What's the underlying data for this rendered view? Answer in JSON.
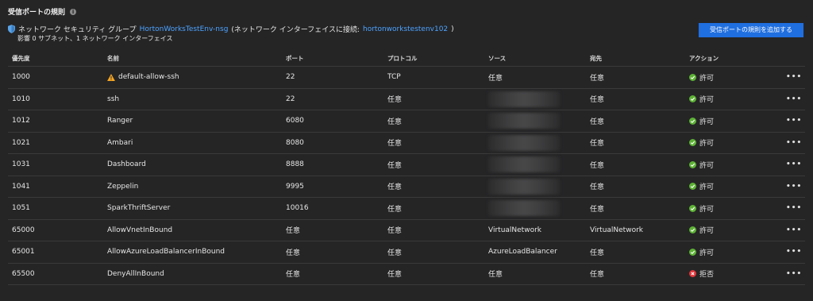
{
  "header": {
    "title": "受信ポートの規則",
    "nsg_prefix": "ネットワーク セキュリティ グループ",
    "nsg_name": "HortonWorksTestEnv-nsg",
    "nsg_middle": "(ネットワーク インターフェイスに接続:",
    "nic_name": "hortonworkstestenv102",
    "nsg_suffix": ")",
    "affects": "影響 0 サブネット、1 ネットワーク インターフェイス",
    "add_button": "受信ポートの規則を追加する"
  },
  "columns": {
    "priority": "優先度",
    "name": "名前",
    "port": "ポート",
    "protocol": "プロトコル",
    "source": "ソース",
    "destination": "宛先",
    "action": "アクション"
  },
  "rows": [
    {
      "priority": "1000",
      "name": "default-allow-ssh",
      "warning": true,
      "port": "22",
      "protocol": "TCP",
      "source": "任意",
      "source_blurred": false,
      "destination": "任意",
      "action": "許可",
      "allow": true
    },
    {
      "priority": "1010",
      "name": "ssh",
      "warning": false,
      "port": "22",
      "protocol": "任意",
      "source": "",
      "source_blurred": true,
      "destination": "任意",
      "action": "許可",
      "allow": true
    },
    {
      "priority": "1012",
      "name": "Ranger",
      "warning": false,
      "port": "6080",
      "protocol": "任意",
      "source": "",
      "source_blurred": true,
      "destination": "任意",
      "action": "許可",
      "allow": true
    },
    {
      "priority": "1021",
      "name": "Ambari",
      "warning": false,
      "port": "8080",
      "protocol": "任意",
      "source": "",
      "source_blurred": true,
      "destination": "任意",
      "action": "許可",
      "allow": true
    },
    {
      "priority": "1031",
      "name": "Dashboard",
      "warning": false,
      "port": "8888",
      "protocol": "任意",
      "source": "",
      "source_blurred": true,
      "destination": "任意",
      "action": "許可",
      "allow": true
    },
    {
      "priority": "1041",
      "name": "Zeppelin",
      "warning": false,
      "port": "9995",
      "protocol": "任意",
      "source": "",
      "source_blurred": true,
      "destination": "任意",
      "action": "許可",
      "allow": true
    },
    {
      "priority": "1051",
      "name": "SparkThriftServer",
      "warning": false,
      "port": "10016",
      "protocol": "任意",
      "source": "",
      "source_blurred": true,
      "destination": "任意",
      "action": "許可",
      "allow": true
    },
    {
      "priority": "65000",
      "name": "AllowVnetInBound",
      "warning": false,
      "port": "任意",
      "protocol": "任意",
      "source": "VirtualNetwork",
      "source_blurred": false,
      "destination": "VirtualNetwork",
      "action": "許可",
      "allow": true
    },
    {
      "priority": "65001",
      "name": "AllowAzureLoadBalancerInBound",
      "warning": false,
      "port": "任意",
      "protocol": "任意",
      "source": "AzureLoadBalancer",
      "source_blurred": false,
      "destination": "任意",
      "action": "許可",
      "allow": true
    },
    {
      "priority": "65500",
      "name": "DenyAllInBound",
      "warning": false,
      "port": "任意",
      "protocol": "任意",
      "source": "任意",
      "source_blurred": false,
      "destination": "任意",
      "action": "拒否",
      "allow": false
    }
  ],
  "more_label": "•••",
  "colors": {
    "background": "#252526",
    "link": "#4da3ff",
    "button": "#1f6fe0",
    "allow": "#5db235",
    "deny": "#e0363b",
    "warning": "#f5a623"
  }
}
